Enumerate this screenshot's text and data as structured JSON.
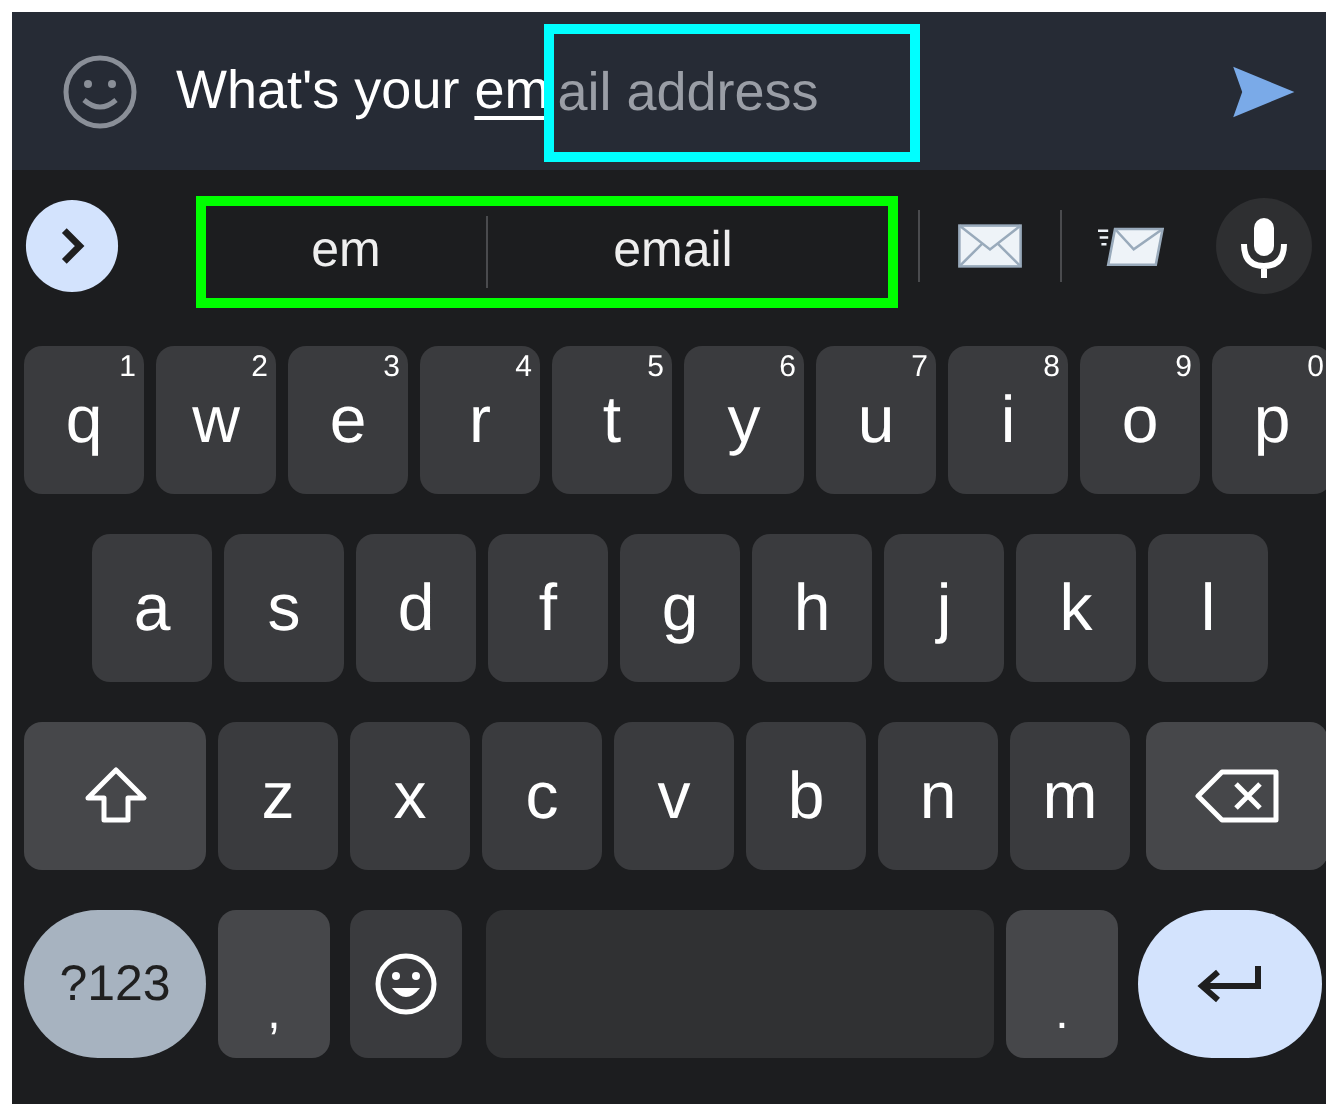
{
  "input": {
    "typed": "What's your ",
    "composing": "em",
    "hint": "ail address"
  },
  "suggestions": {
    "words": [
      "em",
      "email"
    ]
  },
  "rows": [
    [
      {
        "kind": "letter",
        "label": "q",
        "hint": "1"
      },
      {
        "kind": "letter",
        "label": "w",
        "hint": "2"
      },
      {
        "kind": "letter",
        "label": "e",
        "hint": "3"
      },
      {
        "kind": "letter",
        "label": "r",
        "hint": "4"
      },
      {
        "kind": "letter",
        "label": "t",
        "hint": "5"
      },
      {
        "kind": "letter",
        "label": "y",
        "hint": "6"
      },
      {
        "kind": "letter",
        "label": "u",
        "hint": "7"
      },
      {
        "kind": "letter",
        "label": "i",
        "hint": "8"
      },
      {
        "kind": "letter",
        "label": "o",
        "hint": "9"
      },
      {
        "kind": "letter",
        "label": "p",
        "hint": "0"
      }
    ],
    [
      {
        "kind": "letter",
        "label": "a"
      },
      {
        "kind": "letter",
        "label": "s"
      },
      {
        "kind": "letter",
        "label": "d"
      },
      {
        "kind": "letter",
        "label": "f"
      },
      {
        "kind": "letter",
        "label": "g"
      },
      {
        "kind": "letter",
        "label": "h"
      },
      {
        "kind": "letter",
        "label": "j"
      },
      {
        "kind": "letter",
        "label": "k"
      },
      {
        "kind": "letter",
        "label": "l"
      }
    ],
    [
      {
        "kind": "shift"
      },
      {
        "kind": "letter",
        "label": "z"
      },
      {
        "kind": "letter",
        "label": "x"
      },
      {
        "kind": "letter",
        "label": "c"
      },
      {
        "kind": "letter",
        "label": "v"
      },
      {
        "kind": "letter",
        "label": "b"
      },
      {
        "kind": "letter",
        "label": "n"
      },
      {
        "kind": "letter",
        "label": "m"
      },
      {
        "kind": "backspace"
      }
    ],
    [
      {
        "kind": "symbols",
        "label": "?123"
      },
      {
        "kind": "letter",
        "label": ","
      },
      {
        "kind": "emoji"
      },
      {
        "kind": "space"
      },
      {
        "kind": "letter",
        "label": "."
      },
      {
        "kind": "enter"
      }
    ]
  ]
}
